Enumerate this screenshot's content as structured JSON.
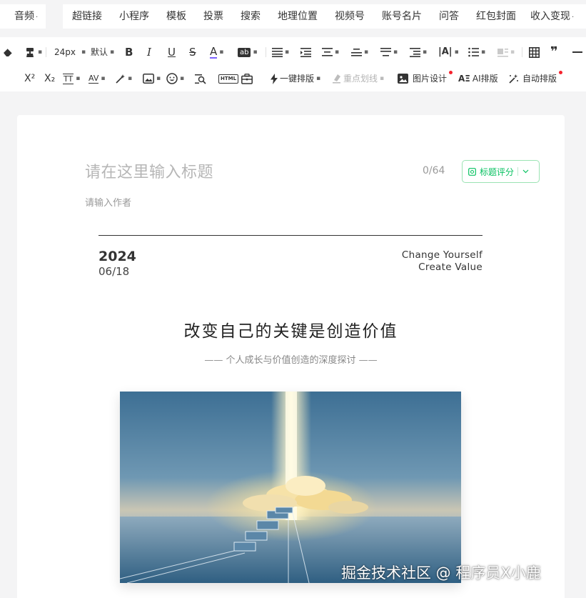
{
  "menu": {
    "items": [
      {
        "label": "音频",
        "has_dropdown": true
      },
      {
        "label": "超链接",
        "has_dropdown": false
      },
      {
        "label": "小程序",
        "has_dropdown": false
      },
      {
        "label": "模板",
        "has_dropdown": false
      },
      {
        "label": "投票",
        "has_dropdown": false
      },
      {
        "label": "搜索",
        "has_dropdown": false
      },
      {
        "label": "地理位置",
        "has_dropdown": false
      },
      {
        "label": "视频号",
        "has_dropdown": false
      },
      {
        "label": "账号名片",
        "has_dropdown": false
      },
      {
        "label": "问答",
        "has_dropdown": false
      },
      {
        "label": "红包封面",
        "has_dropdown": false
      },
      {
        "label": "收入变现",
        "has_dropdown": true
      }
    ]
  },
  "toolbar": {
    "font_size": "24px",
    "font_family": "默认",
    "bold": "B",
    "italic": "I",
    "underline": "U",
    "strike": "S",
    "font_color": "A",
    "font_color_bar": "#7b61ff",
    "bg_color_label": "ab",
    "superscript": "X²",
    "subscript": "X₂",
    "letter_spacing_label": "AV",
    "html_label": "HTML",
    "quote_glyph": "❞",
    "one_click_layout": "一键排版",
    "highlight_line": "重点划线",
    "image_design": "图片设计",
    "ai_layout_badge": "AΞ",
    "ai_layout": "AI排版",
    "auto_layout": "自动排版",
    "accent_red": "#f5222d"
  },
  "editor": {
    "title_placeholder": "请在这里输入标题",
    "title_count": "0/64",
    "score_button": "标题评分",
    "author_placeholder": "请输入作者",
    "brand_green": "#07c160"
  },
  "article": {
    "year": "2024",
    "month_day": "06/18",
    "slogan_line1": "Change Yourself",
    "slogan_line2": "Create Value",
    "title": "改变自己的关键是创造价值",
    "subtitle": "—— 个人成长与价值创造的深度探讨 ——"
  },
  "watermark": "掘金技术社区 @ 程序员X小鹿"
}
